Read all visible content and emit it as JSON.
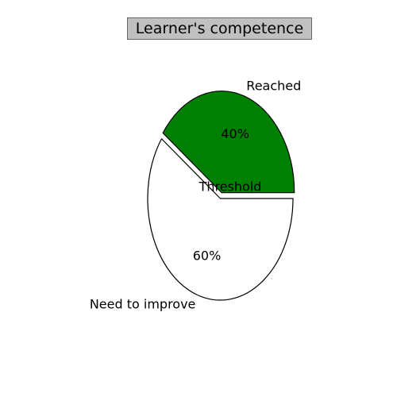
{
  "chart_data": {
    "type": "pie",
    "title": "Learner's competence",
    "center_label": "Threshold",
    "slices": [
      {
        "label": "Reached",
        "value": 40,
        "percent_label": "40%",
        "color": "#008000",
        "exploded": true
      },
      {
        "label": "Need to improve",
        "value": 60,
        "percent_label": "60%",
        "color": "#ffffff",
        "exploded": false
      }
    ],
    "start_angle_deg": 0,
    "direction": "counterclockwise",
    "legend": "none",
    "grid": false
  }
}
